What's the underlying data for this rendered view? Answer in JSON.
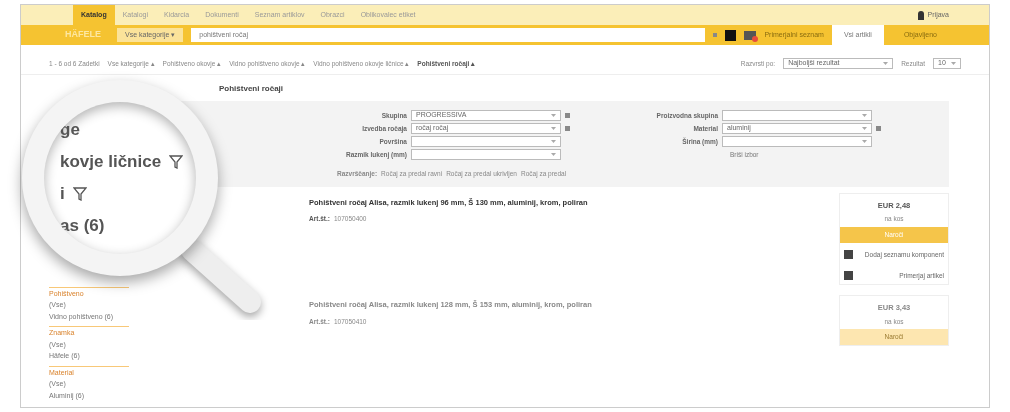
{
  "nav": {
    "items": [
      {
        "label": "Katalog",
        "selected": true
      },
      {
        "label": "Katalogi",
        "selected": false
      },
      {
        "label": "Kidarcia",
        "selected": false
      },
      {
        "label": "Dokumenti",
        "selected": false
      },
      {
        "label": "Seznam artiklov",
        "selected": false
      },
      {
        "label": "Obrazci",
        "selected": false
      },
      {
        "label": "Oblikovalec etiket",
        "selected": false
      }
    ],
    "login": "Prijava"
  },
  "search": {
    "logo": "HÄFELE",
    "category": "Vse kategorije ▾",
    "value": "pohištveni ročaj",
    "compare": "Primerjalni seznam",
    "tabs": [
      {
        "label": "Vsi artikli",
        "selected": true
      },
      {
        "label": "Objavljeno",
        "selected": false
      }
    ]
  },
  "breadcrumb": {
    "count": "1 - 6 od 6 Zadetki",
    "items": [
      "Vse kategorije ▴",
      "Pohištveno okovje ▴",
      "Vidno pohištveno okovje ▴",
      "Vidno pohištveno okovje ličnice ▴",
      "Pohištveni ročaji ▴"
    ],
    "sort_label": "Razvrsti po:",
    "sort_value": "Najboljši rezultat",
    "per_page_label": "Rezultat",
    "per_page_value": "10"
  },
  "sidebar": {
    "groups": [
      {
        "title": "Pohištveno",
        "items": [
          "(Vse)",
          "Vidno pohištveno (6)"
        ]
      },
      {
        "title": "Znamka",
        "items": [
          "(Vse)",
          "Häfele (6)"
        ]
      },
      {
        "title": "Material",
        "items": [
          "(Vse)",
          "Aluminij (6)"
        ]
      }
    ]
  },
  "heading": "Pohištveni ročaji",
  "filters": {
    "left": [
      {
        "label": "Skupina",
        "value": "PROGRESSIVA"
      },
      {
        "label": "Izvedba ročaja",
        "value": "ročaj ročaj"
      },
      {
        "label": "Površina"
      },
      {
        "label": "Razmik lukenj (mm)"
      }
    ],
    "right": [
      {
        "label": "Proizvodna skupina"
      },
      {
        "label": "Material",
        "value": "aluminij"
      },
      {
        "label": "Širina (mm)"
      }
    ],
    "clear": "Briši izbor"
  },
  "sorting": {
    "label": "Razvrščanje:",
    "options": [
      "Ročaj za predal ravni",
      "Ročaj za predal ukrivljen",
      "Ročaj za predal"
    ]
  },
  "products": [
    {
      "title": "Pohištveni ročaj Alisa, razmik lukenj 96 mm, Š 130 mm, aluminij, krom, poliran",
      "art_label": "Art.št.:",
      "art": "107050400",
      "price": "EUR 2,48",
      "unit": "na kos",
      "order": "Naroči",
      "actions": [
        "Dodaj seznamu komponent",
        "Primerjaj artikel"
      ],
      "faded": false
    },
    {
      "title": "Pohištveni ročaj Alisa, razmik lukenj 128 mm, Š 153 mm, aluminij, krom, poliran",
      "art_label": "Art.št.:",
      "art": "107050410",
      "price": "EUR 3,43",
      "unit": "na kos",
      "order": "Naroči",
      "faded": true
    }
  ],
  "magnifier": {
    "lines": [
      {
        "text": "ge",
        "filter": false
      },
      {
        "text": "kovje ličnice",
        "filter": true
      },
      {
        "text": "i",
        "filter": true
      },
      {
        "text": "as (6)",
        "filter": false
      }
    ]
  }
}
